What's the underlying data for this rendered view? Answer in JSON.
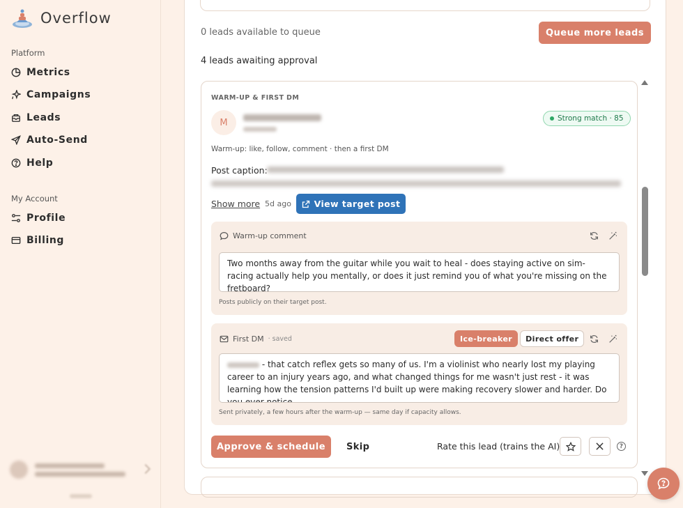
{
  "brand": {
    "name": "Overflow"
  },
  "sidebar": {
    "platform_label": "Platform",
    "platform_items": [
      {
        "label": "Metrics",
        "icon": "pie-chart-icon"
      },
      {
        "label": "Campaigns",
        "icon": "sparkle-icon"
      },
      {
        "label": "Leads",
        "icon": "inbox-icon"
      },
      {
        "label": "Auto-Send",
        "icon": "send-icon"
      },
      {
        "label": "Help",
        "icon": "help-circle-icon"
      }
    ],
    "account_label": "My Account",
    "account_items": [
      {
        "label": "Profile",
        "icon": "sliders-icon"
      },
      {
        "label": "Billing",
        "icon": "credit-card-icon"
      }
    ]
  },
  "queue": {
    "available_text": "0 leads available to queue",
    "queue_button": "Queue more leads",
    "awaiting_text": "4 leads awaiting approval"
  },
  "lead": {
    "kicker": "WARM-UP & FIRST DM",
    "avatar_initial": "M",
    "match_badge": "Strong match · 85",
    "warmup_note": "Warm-up: like, follow, comment · then a first DM",
    "caption_label": "Post caption:",
    "show_more": "Show more",
    "posted_ago": "5d ago",
    "view_post_button": "View target post",
    "warmup": {
      "title": "Warm-up comment",
      "text": "Two months away from the guitar while you wait to heal - does staying active on sim-racing actually help you mentally, or does it just remind you of what you're missing on the fretboard?",
      "footnote": "Posts publicly on their target post."
    },
    "dm": {
      "title": "First DM",
      "saved": "· saved",
      "tab_icebreaker": "Ice-breaker",
      "tab_direct": "Direct offer",
      "text": "- that catch reflex gets so many of us. I'm a violinist who nearly lost my playing career to an injury years ago, and what changed things for me wasn't just rest - it was learning how the tension patterns I'd built up were making recovery slower and harder. Do you ever notice",
      "footnote": "Sent privately, a few hours after the warm-up — same day if capacity allows."
    },
    "approve_button": "Approve & schedule",
    "skip_button": "Skip",
    "rate_label": "Rate this lead (trains the AI):"
  },
  "colors": {
    "accent": "#d9806a",
    "blue": "#2f73b8",
    "match_green": "#2fa866",
    "background": "#fdf1e8"
  }
}
